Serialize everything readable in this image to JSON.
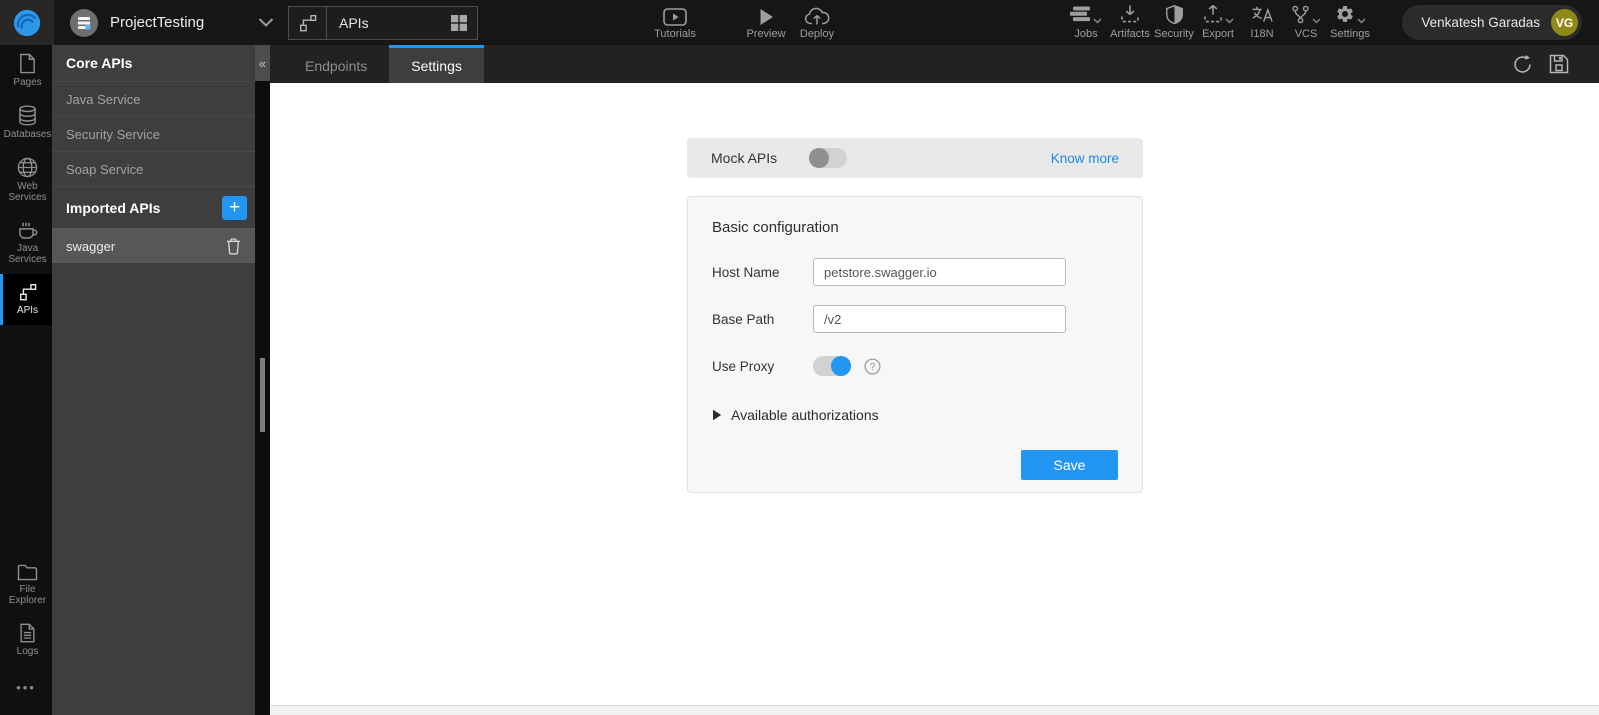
{
  "topbar": {
    "project": {
      "name": "ProjectTesting"
    },
    "selector": {
      "label": "APIs"
    },
    "tools": {
      "tutorials": "Tutorials",
      "preview": "Preview",
      "deploy": "Deploy"
    },
    "right_tools": [
      {
        "label": "Jobs",
        "icon": "jobs-icon",
        "chevron": true
      },
      {
        "label": "Artifacts",
        "icon": "artifacts-icon",
        "chevron": false
      },
      {
        "label": "Security",
        "icon": "security-icon",
        "chevron": false
      },
      {
        "label": "Export",
        "icon": "export-icon",
        "chevron": true
      },
      {
        "label": "I18N",
        "icon": "i18n-icon",
        "chevron": false
      },
      {
        "label": "VCS",
        "icon": "vcs-icon",
        "chevron": true
      },
      {
        "label": "Settings",
        "icon": "settings-icon",
        "chevron": true
      }
    ],
    "user": {
      "name": "Venkatesh Garadas",
      "initials": "VG"
    }
  },
  "left_rail": [
    {
      "label": "Pages",
      "icon": "pages-icon",
      "active": false
    },
    {
      "label": "Databases",
      "icon": "databases-icon",
      "active": false
    },
    {
      "label": "Web Services",
      "icon": "web-services-icon",
      "active": false
    },
    {
      "label": "Java Services",
      "icon": "java-services-icon",
      "active": false
    },
    {
      "label": "APIs",
      "icon": "apis-icon",
      "active": true
    }
  ],
  "left_rail_bottom": [
    {
      "label": "File Explorer",
      "icon": "file-explorer-icon"
    },
    {
      "label": "Logs",
      "icon": "logs-icon"
    }
  ],
  "sidebar": {
    "core_header": "Core APIs",
    "core_items": [
      "Java Service",
      "Security Service",
      "Soap Service"
    ],
    "imported_header": "Imported APIs",
    "imported_items": [
      "swagger"
    ],
    "selected_item": "swagger"
  },
  "tabbar": {
    "tabs": [
      "Endpoints",
      "Settings"
    ],
    "active": "Settings"
  },
  "settings_page": {
    "mock": {
      "label": "Mock APIs",
      "enabled": false,
      "link": "Know more"
    },
    "basic": {
      "title": "Basic configuration",
      "fields": [
        {
          "label": "Host Name",
          "value": "petstore.swagger.io"
        },
        {
          "label": "Base Path",
          "value": "/v2"
        }
      ],
      "proxy": {
        "label": "Use Proxy",
        "enabled": true
      },
      "authorizations_label": "Available authorizations",
      "save_label": "Save"
    }
  },
  "glyphs": {
    "collapse": "«",
    "add": "+",
    "more": "•••",
    "help": "?"
  },
  "colors": {
    "accent": "#2196f3",
    "link": "#1e88e5",
    "avatar_bg": "#8f8a15"
  }
}
